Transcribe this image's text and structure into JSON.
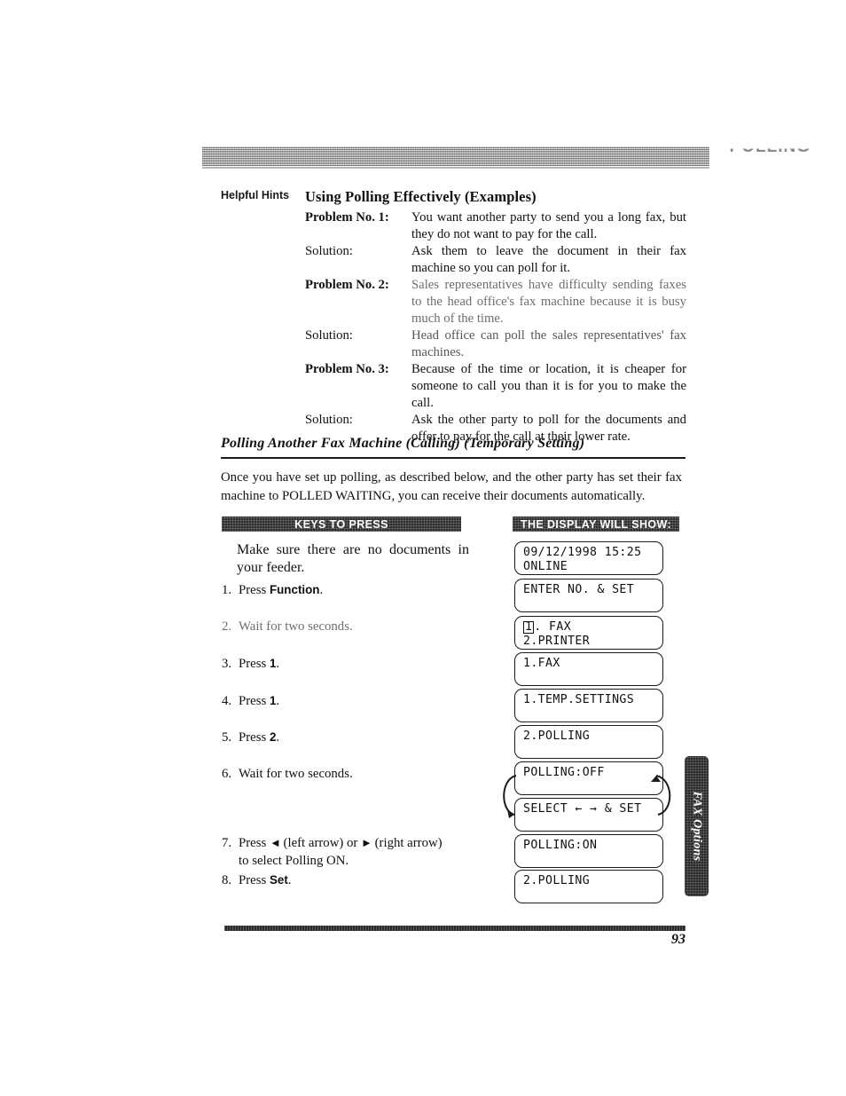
{
  "header": {
    "running_head": "POLLING"
  },
  "hints": {
    "label": "Helpful Hints",
    "title": "Using Polling Effectively (Examples)",
    "entries": [
      {
        "label": "Problem No. 1:",
        "bold": true,
        "text": "You want another party to send you a long fax, but they do not want to pay for the call."
      },
      {
        "label": "Solution:",
        "bold": false,
        "text": "Ask them to leave the document in their fax machine so you can poll for it."
      },
      {
        "label": "Problem No. 2:",
        "bold": true,
        "text": "Sales representatives have difficulty sending faxes to the head office's fax machine because it is busy much of the time."
      },
      {
        "label": "Solution:",
        "bold": false,
        "text": "Head office can poll the sales representatives' fax machines."
      },
      {
        "label": "Problem No. 3:",
        "bold": true,
        "text": "Because of the time or location, it is cheaper for someone to call you than it is for you to make the call."
      },
      {
        "label": "Solution:",
        "bold": false,
        "text": "Ask the other party to poll for the documents and offer to pay for the call at their lower rate."
      }
    ]
  },
  "section": {
    "heading": "Polling Another Fax Machine (Calling)  (Temporary Setting)",
    "intro": "Once you have set up polling, as described below, and the other party has set their fax machine to POLLED WAITING, you can receive their documents automatically."
  },
  "columns": {
    "keys_header": "KEYS TO PRESS",
    "display_header": "THE DISPLAY WILL SHOW:"
  },
  "procedure": {
    "intro": "Make sure there are no documents in your feeder.",
    "steps": [
      {
        "num": "1.",
        "prefix": "Press ",
        "key": "Function",
        "suffix": ".",
        "plain": ""
      },
      {
        "num": "2.",
        "prefix": "",
        "key": "",
        "suffix": "",
        "plain": "Wait for two seconds."
      },
      {
        "num": "3.",
        "prefix": "Press ",
        "key": "1",
        "suffix": ".",
        "plain": ""
      },
      {
        "num": "4.",
        "prefix": "Press ",
        "key": "1",
        "suffix": ".",
        "plain": ""
      },
      {
        "num": "5.",
        "prefix": "Press ",
        "key": "2",
        "suffix": ".",
        "plain": ""
      },
      {
        "num": "6.",
        "prefix": "",
        "key": "",
        "suffix": "",
        "plain": "Wait for two seconds."
      },
      {
        "num": "7.",
        "prefix": "",
        "key": "",
        "suffix": "",
        "plain": ""
      },
      {
        "num": "8.",
        "prefix": "Press ",
        "key": "Set",
        "suffix": ".",
        "plain": ""
      }
    ],
    "step7": {
      "press": "Press ",
      "left_arrow": "◄",
      "left_label": " (left arrow) or ",
      "right_arrow": "►",
      "right_label": " (right arrow)",
      "line2": "to select Polling ON."
    }
  },
  "displays": [
    {
      "line1": "09/12/1998 15:25",
      "line2": "ONLINE",
      "cursor": ""
    },
    {
      "line1": "ENTER NO. & SET",
      "line2": "",
      "cursor": ""
    },
    {
      "line1": ". FAX",
      "line2": "2.PRINTER",
      "cursor": "1"
    },
    {
      "line1": "1.FAX",
      "line2": "",
      "cursor": ""
    },
    {
      "line1": "1.TEMP.SETTINGS",
      "line2": "",
      "cursor": ""
    },
    {
      "line1": "2.POLLING",
      "line2": "",
      "cursor": ""
    },
    {
      "line1": "POLLING:OFF",
      "line2": "",
      "cursor": ""
    },
    {
      "line1": "SELECT ← → & SET",
      "line2": "",
      "cursor": ""
    },
    {
      "line1": "POLLING:ON",
      "line2": "",
      "cursor": ""
    },
    {
      "line1": "2.POLLING",
      "line2": "",
      "cursor": ""
    }
  ],
  "side_tab": {
    "label": "FAX Options"
  },
  "footer": {
    "page_number": "93"
  }
}
